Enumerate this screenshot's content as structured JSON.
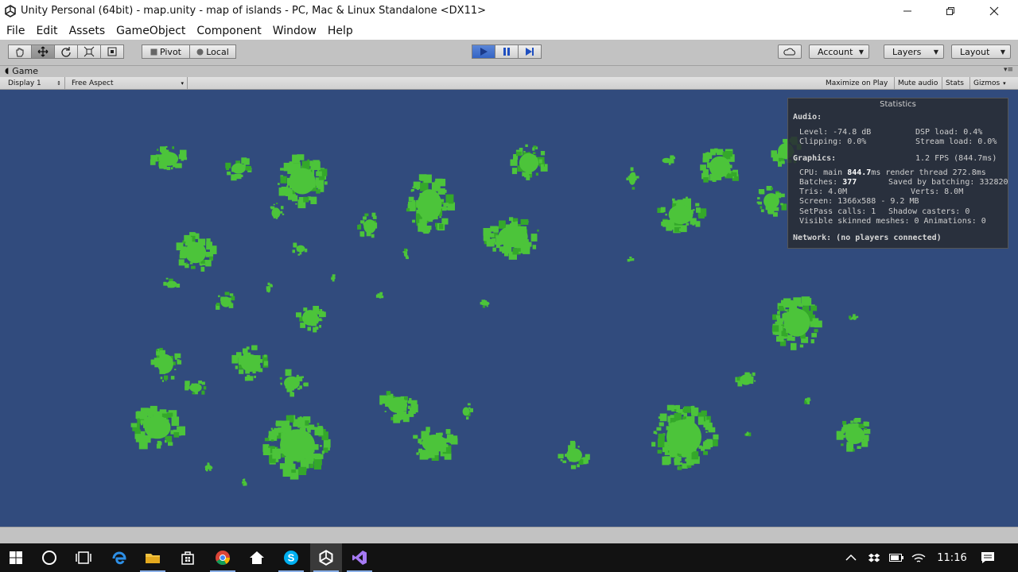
{
  "window": {
    "title": "Unity Personal (64bit) - map.unity - map of islands - PC, Mac & Linux Standalone <DX11>"
  },
  "menu": [
    "File",
    "Edit",
    "Assets",
    "GameObject",
    "Component",
    "Window",
    "Help"
  ],
  "toolbar": {
    "pivot_label": "Pivot",
    "local_label": "Local",
    "account_label": "Account",
    "layers_label": "Layers",
    "layout_label": "Layout"
  },
  "game_tab": {
    "label": "Game",
    "display_select": "Display 1",
    "aspect_select": "Free Aspect",
    "maximize_on_play": "Maximize on Play",
    "mute_audio": "Mute audio",
    "stats": "Stats",
    "gizmos": "Gizmos"
  },
  "statistics": {
    "title": "Statistics",
    "audio_header": "Audio:",
    "level": "Level: -74.8 dB",
    "clipping": "Clipping: 0.0%",
    "dsp_load": "DSP load: 0.4%",
    "stream_load": "Stream load: 0.0%",
    "graphics_header": "Graphics:",
    "fps": "1.2 FPS (844.7ms)",
    "cpu_prefix": "CPU: main ",
    "cpu_main": "844.7",
    "cpu_rest": "ms  render thread 272.8ms",
    "batches_prefix": "Batches: ",
    "batches": "377",
    "saved_batching": "Saved by batching: 332820",
    "tris": "Tris: 4.0M",
    "verts": "Verts: 8.0M",
    "screen": "Screen: 1366x588 - 9.2 MB",
    "setpass": "SetPass calls: 1",
    "shadow_casters": "Shadow casters: 0",
    "skinned_meshes": "Visible skinned meshes: 0  Animations: 0",
    "network": "Network: (no players connected)"
  },
  "colors": {
    "ocean": "#314b7d",
    "land": "#4cc43a",
    "land_dark": "#34a82a"
  },
  "taskbar": {
    "clock": "11:16",
    "icons": [
      "windows-start-icon",
      "cortana-icon",
      "task-view-icon",
      "edge-icon",
      "file-explorer-icon",
      "store-icon",
      "chrome-icon",
      "home-icon",
      "skype-icon",
      "unity-icon",
      "visual-studio-icon"
    ]
  }
}
